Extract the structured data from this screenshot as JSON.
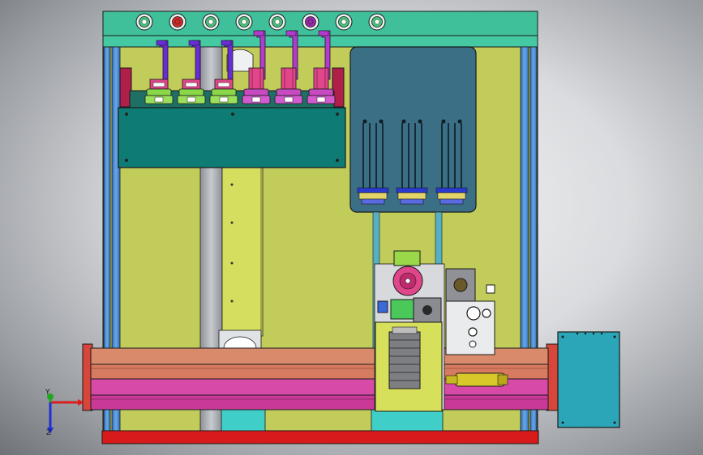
{
  "viewport": {
    "background_center": "#f4f5f6",
    "background_edge": "#6f7276"
  },
  "triad": {
    "y_label": "Y",
    "z_label": "Z",
    "x_axis_color": "#d81e1e",
    "y_axis_color": "#1ea81e",
    "z_axis_color": "#1e2ed8"
  },
  "colors": {
    "frame_yellow": "#c2cc5a",
    "teal_panel": "#3fbf9a",
    "dark_teal": "#0e7c74",
    "blue_post": "#4a8fd6",
    "grey_rail": "#a9adb3",
    "red_base": "#d91a1a",
    "salmon_rail": "#d98a6a",
    "magenta_rail": "#d84aa8",
    "slate_cover": "#3a6f86",
    "cyan_box": "#2aa6b8",
    "motor_grey": "#bdbdbd",
    "violet_arm": "#6a2bd8",
    "purple_arm": "#b23ad0",
    "pink_part": "#e0468a",
    "button_green": "#46c07a",
    "button_red": "#d12a2a",
    "button_purple": "#9a2aa8"
  },
  "control_panel": {
    "buttons": [
      "green",
      "red",
      "green",
      "green",
      "green",
      "purple",
      "green",
      "green"
    ]
  }
}
